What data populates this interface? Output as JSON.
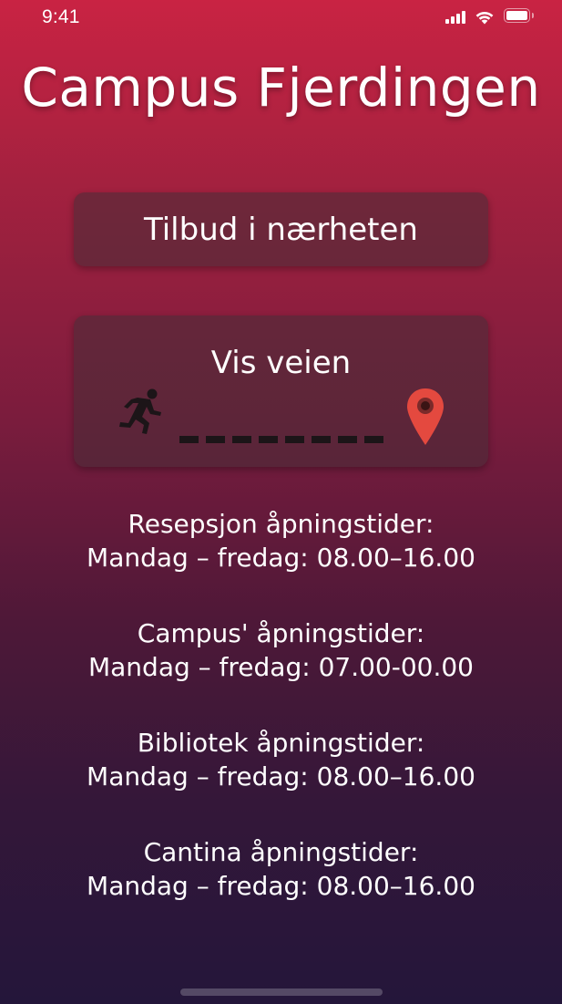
{
  "status_bar": {
    "time": "9:41"
  },
  "header": {
    "title": "Campus Fjerdingen"
  },
  "buttons": {
    "offers_label": "Tilbud i nærheten",
    "route_label": "Vis veien"
  },
  "icons": {
    "runner": "running-person-icon",
    "pin": "map-pin-icon",
    "pin_color": "#e4493f"
  },
  "hours": [
    {
      "heading": "Resepsjon åpningstider:",
      "times": "Mandag – fredag: 08.00–16.00"
    },
    {
      "heading": "Campus' åpningstider:",
      "times": "Mandag – fredag: 07.00-00.00"
    },
    {
      "heading": "Bibliotek åpningstider:",
      "times": "Mandag – fredag: 08.00–16.00"
    },
    {
      "heading": "Cantina åpningstider:",
      "times": "Mandag – fredag: 08.00–16.00"
    }
  ]
}
